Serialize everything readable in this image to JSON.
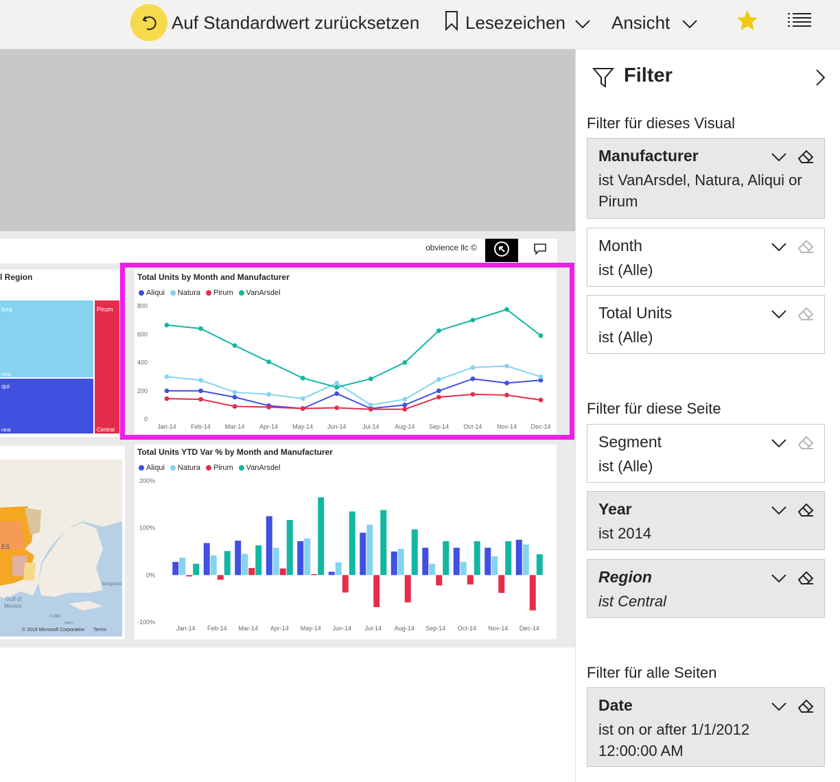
{
  "toolbar": {
    "reset_label": "Auf Standardwert zurücksetzen",
    "bookmarks_label": "Lesezeichen",
    "view_label": "Ansicht"
  },
  "report": {
    "credit": "obvience llc ©",
    "treemap": {
      "title_fragment": "l Region",
      "labels": [
        "tura",
        "Pirum",
        "ntral",
        "qui",
        "ntral",
        "Central"
      ]
    },
    "map": {
      "labels": [
        "ES",
        "Sargasso",
        "Gulf of",
        "Mexico",
        "CUBA",
        "HAITI",
        "© 2019 Microsoft Corporation",
        "Terms"
      ]
    }
  },
  "chart_data": [
    {
      "type": "line",
      "title": "Total Units by Month and Manufacturer",
      "categories": [
        "Jan-14",
        "Feb-14",
        "Mar-14",
        "Apr-14",
        "May-14",
        "Jun-14",
        "Jul-14",
        "Aug-14",
        "Sep-14",
        "Oct-14",
        "Nov-14",
        "Dec-14"
      ],
      "yticks": [
        "800",
        "600",
        "400",
        "200",
        "0"
      ],
      "ylim": [
        0,
        800
      ],
      "series": [
        {
          "name": "Aliqui",
          "color": "#4050e0",
          "values": [
            200,
            200,
            155,
            95,
            75,
            180,
            75,
            100,
            200,
            285,
            255,
            275
          ]
        },
        {
          "name": "Natura",
          "color": "#85d3ee",
          "values": [
            300,
            275,
            190,
            175,
            145,
            255,
            100,
            140,
            280,
            365,
            375,
            300
          ]
        },
        {
          "name": "Pirum",
          "color": "#e52d4b",
          "values": [
            145,
            140,
            90,
            85,
            75,
            80,
            70,
            70,
            155,
            175,
            170,
            135
          ]
        },
        {
          "name": "VanArsdel",
          "color": "#12b7a1",
          "values": [
            665,
            640,
            520,
            405,
            290,
            225,
            285,
            400,
            625,
            700,
            775,
            590
          ]
        }
      ]
    },
    {
      "type": "bar",
      "title": "Total Units YTD Var % by Month and Manufacturer",
      "categories": [
        "Jan-14",
        "Feb-14",
        "Mar-14",
        "Apr-14",
        "May-14",
        "Jun-14",
        "Jul-14",
        "Aug-14",
        "Sep-14",
        "Oct-14",
        "Nov-14",
        "Dec-14"
      ],
      "yticks": [
        "200%",
        "100%",
        "0%",
        "-100%"
      ],
      "ylim": [
        -100,
        200
      ],
      "series": [
        {
          "name": "Aliqui",
          "color": "#4050e0",
          "values": [
            28,
            68,
            73,
            125,
            72,
            7,
            90,
            50,
            58,
            58,
            58,
            75
          ]
        },
        {
          "name": "Natura",
          "color": "#85d3ee",
          "values": [
            37,
            42,
            45,
            58,
            78,
            27,
            107,
            56,
            24,
            28,
            40,
            65
          ]
        },
        {
          "name": "Pirum",
          "color": "#e52d4b",
          "values": [
            -3,
            -10,
            15,
            14,
            2,
            -37,
            -68,
            -58,
            -22,
            -20,
            -38,
            -75
          ]
        },
        {
          "name": "VanArsdel",
          "color": "#12b7a1",
          "values": [
            24,
            51,
            63,
            117,
            165,
            135,
            138,
            97,
            72,
            72,
            72,
            44
          ]
        }
      ]
    }
  ],
  "filters": {
    "pane_title": "Filter",
    "visual_section": "Filter für dieses Visual",
    "page_section": "Filter für diese Seite",
    "all_section": "Filter für alle Seiten",
    "manufacturer": {
      "title": "Manufacturer",
      "value": "ist VanArsdel, Natura, Aliqui or Pirum"
    },
    "month": {
      "title": "Month",
      "value": "ist (Alle)"
    },
    "total_units": {
      "title": "Total Units",
      "value": "ist (Alle)"
    },
    "segment": {
      "title": "Segment",
      "value": "ist (Alle)"
    },
    "year": {
      "title": "Year",
      "value": "ist 2014"
    },
    "region": {
      "title": "Region",
      "value": "ist Central"
    },
    "date": {
      "title": "Date",
      "value": "ist on or after 1/1/2012 12:00:00 AM"
    }
  }
}
